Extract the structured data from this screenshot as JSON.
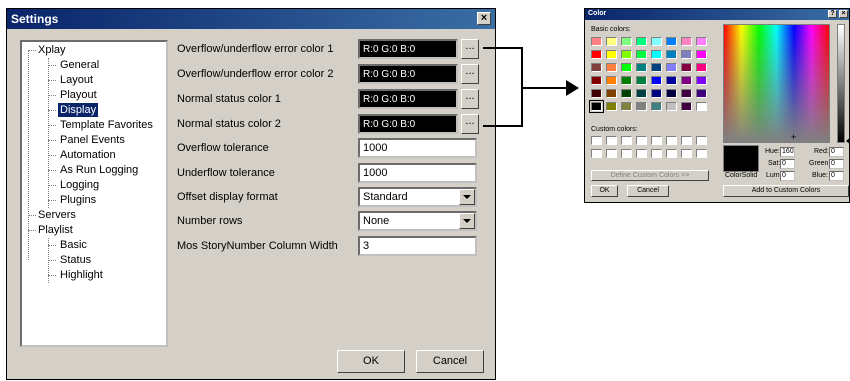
{
  "settings": {
    "title": "Settings",
    "close_glyph": "×",
    "tree": {
      "root": "Xplay",
      "children": [
        "General",
        "Layout",
        "Playout",
        "Display",
        "Template Favorites",
        "Panel Events",
        "Automation",
        "As Run Logging",
        "Logging",
        "Plugins"
      ],
      "servers": "Servers",
      "playlist": "Playlist",
      "playlist_children": [
        "Basic",
        "Status",
        "Highlight"
      ],
      "selected": "Display"
    },
    "rows": {
      "overflow_color_label": "Overflow/underflow error color 1",
      "overflow_color_value": "R:0 G:0 B:0",
      "overflow_color2_label": "Overflow/underflow error color 2",
      "overflow_color2_value": "R:0 G:0 B:0",
      "normal_color1_label": "Normal status color 1",
      "normal_color1_value": "R:0 G:0 B:0",
      "normal_color2_label": "Normal status color 2",
      "normal_color2_value": "R:0 G:0 B:0",
      "dots": "...",
      "overflow_tol_label": "Overflow tolerance",
      "overflow_tol_value": "1000",
      "underflow_tol_label": "Underflow tolerance",
      "underflow_tol_value": "1000",
      "offset_format_label": "Offset display format",
      "offset_format_value": "Standard",
      "number_rows_label": "Number rows",
      "number_rows_value": "None",
      "mos_width_label": "Mos StoryNumber Column Width",
      "mos_width_value": "3"
    },
    "ok": "OK",
    "cancel": "Cancel"
  },
  "color_dialog": {
    "title": "Color",
    "help_glyph": "?",
    "close_glyph": "×",
    "basic_colors_label": "Basic colors:",
    "custom_colors_label": "Custom colors:",
    "define_button": "Define Custom Colors >>",
    "ok": "OK",
    "cancel": "Cancel",
    "colorsolid_label": "Color|Solid",
    "hue_label": "Hue:",
    "hue_value": "160",
    "sat_label": "Sat:",
    "sat_value": "0",
    "lum_label": "Lum:",
    "lum_value": "0",
    "red_label": "Red:",
    "red_value": "0",
    "green_label": "Green:",
    "green_value": "0",
    "blue_label": "Blue:",
    "blue_value": "0",
    "add_button": "Add to Custom Colors",
    "basic_palette": [
      [
        "#ff8080",
        "#ffff80",
        "#80ff80",
        "#00ff80",
        "#80ffff",
        "#0080ff",
        "#ff80c0",
        "#ff80ff"
      ],
      [
        "#ff0000",
        "#ffff00",
        "#80ff00",
        "#00ff40",
        "#00ffff",
        "#0080c0",
        "#8080c0",
        "#ff00ff"
      ],
      [
        "#804040",
        "#ff8040",
        "#00ff00",
        "#008080",
        "#004080",
        "#8080ff",
        "#800040",
        "#ff0080"
      ],
      [
        "#800000",
        "#ff8000",
        "#008000",
        "#008040",
        "#0000ff",
        "#0000a0",
        "#800080",
        "#8000ff"
      ],
      [
        "#400000",
        "#804000",
        "#004000",
        "#004040",
        "#000080",
        "#000040",
        "#400040",
        "#400080"
      ],
      [
        "#000000",
        "#808000",
        "#808040",
        "#808080",
        "#408080",
        "#c0c0c0",
        "#400040",
        "#ffffff"
      ]
    ]
  }
}
